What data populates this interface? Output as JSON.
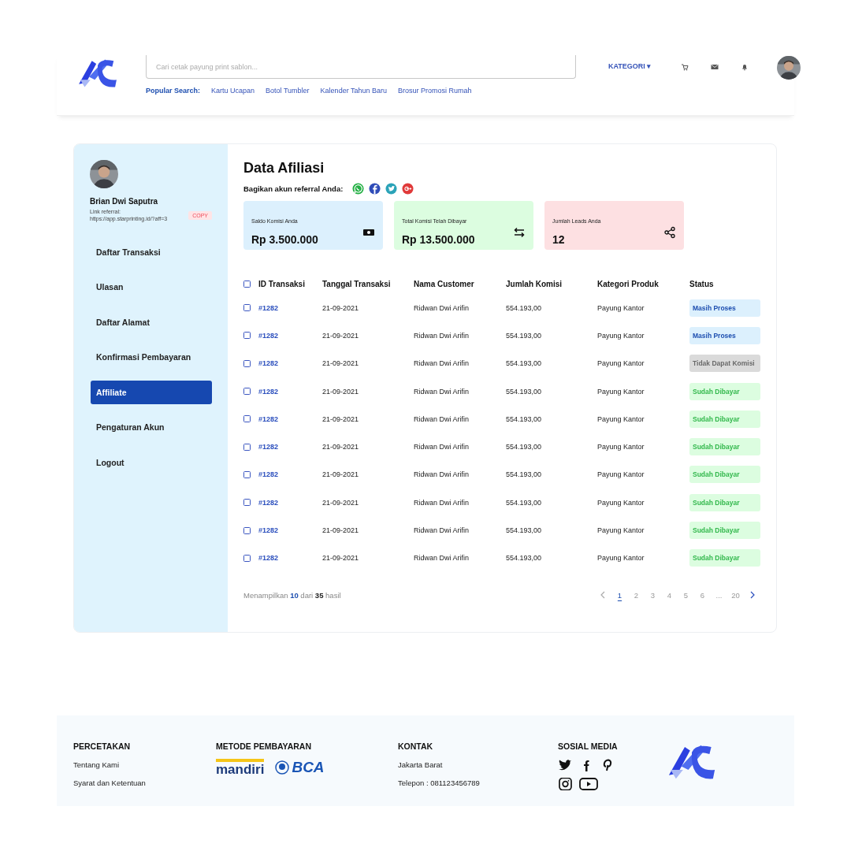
{
  "header": {
    "search": {
      "placeholder": "Cari cetak payung print sablon..."
    },
    "popular_label": "Popular Search:",
    "popular": [
      "Kartu Ucapan",
      "Botol Tumbler",
      "Kalender Tahun Baru",
      "Brosur Promosi Rumah"
    ],
    "category": "KATEGORI ▾"
  },
  "profile": {
    "name": "Brian Dwi Saputra",
    "referral_label": "Link referral:",
    "referral_link": "https://app.starprinting.id/?aff=3",
    "copy": "COPY"
  },
  "menu": [
    {
      "label": "Daftar Transaksi",
      "selected": false
    },
    {
      "label": "Ulasan",
      "selected": false
    },
    {
      "label": "Daftar Alamat",
      "selected": false
    },
    {
      "label": "Konfirmasi Pembayaran",
      "selected": false
    },
    {
      "label": "Affiliate",
      "selected": true
    },
    {
      "label": "Pengaturan Akun",
      "selected": false
    },
    {
      "label": "Logout",
      "selected": false
    }
  ],
  "page_title": "Data Afiliasi",
  "share_label": "Bagikan akun referral Anda:",
  "stats": [
    {
      "label": "Saldo Komisi Anda",
      "value": "Rp 3.500.000",
      "color": "#dcf0fd",
      "kind": "money"
    },
    {
      "label": "Total Komisi Telah Dibayar",
      "value": "Rp 13.500.000",
      "color": "#dcfde0",
      "kind": "transfer"
    },
    {
      "label": "Jumlah Leads Anda",
      "value": "12",
      "color": "#fde0e2",
      "kind": "share"
    }
  ],
  "table": {
    "header_checked": false,
    "columns": [
      "ID Transaksi",
      "Tanggal Transaksi",
      "Nama Customer",
      "Jumlah Komisi",
      "Kategori Produk",
      "Status"
    ],
    "rows": [
      {
        "checked": false,
        "id": "#1282",
        "date": "21-09-2021",
        "customer": "Ridwan Dwi Arifin",
        "amount": "554.193,00",
        "category": "Payung Kantor",
        "status": "Masih Proses",
        "kind": "process"
      },
      {
        "checked": false,
        "id": "#1282",
        "date": "21-09-2021",
        "customer": "Ridwan Dwi Arifin",
        "amount": "554.193,00",
        "category": "Payung Kantor",
        "status": "Masih Proses",
        "kind": "process"
      },
      {
        "checked": false,
        "id": "#1282",
        "date": "21-09-2021",
        "customer": "Ridwan Dwi Arifin",
        "amount": "554.193,00",
        "category": "Payung Kantor",
        "status": "Tidak Dapat Komisi",
        "kind": "none"
      },
      {
        "checked": false,
        "id": "#1282",
        "date": "21-09-2021",
        "customer": "Ridwan Dwi Arifin",
        "amount": "554.193,00",
        "category": "Payung Kantor",
        "status": "Sudah Dibayar",
        "kind": "paid"
      },
      {
        "checked": false,
        "id": "#1282",
        "date": "21-09-2021",
        "customer": "Ridwan Dwi Arifin",
        "amount": "554.193,00",
        "category": "Payung Kantor",
        "status": "Sudah Dibayar",
        "kind": "paid"
      },
      {
        "checked": false,
        "id": "#1282",
        "date": "21-09-2021",
        "customer": "Ridwan Dwi Arifin",
        "amount": "554.193,00",
        "category": "Payung Kantor",
        "status": "Sudah Dibayar",
        "kind": "paid"
      },
      {
        "checked": false,
        "id": "#1282",
        "date": "21-09-2021",
        "customer": "Ridwan Dwi Arifin",
        "amount": "554.193,00",
        "category": "Payung Kantor",
        "status": "Sudah Dibayar",
        "kind": "paid"
      },
      {
        "checked": false,
        "id": "#1282",
        "date": "21-09-2021",
        "customer": "Ridwan Dwi Arifin",
        "amount": "554.193,00",
        "category": "Payung Kantor",
        "status": "Sudah Dibayar",
        "kind": "paid"
      },
      {
        "checked": false,
        "id": "#1282",
        "date": "21-09-2021",
        "customer": "Ridwan Dwi Arifin",
        "amount": "554.193,00",
        "category": "Payung Kantor",
        "status": "Sudah Dibayar",
        "kind": "paid"
      },
      {
        "checked": false,
        "id": "#1282",
        "date": "21-09-2021",
        "customer": "Ridwan Dwi Arifin",
        "amount": "554.193,00",
        "category": "Payung Kantor",
        "status": "Sudah Dibayar",
        "kind": "paid"
      }
    ]
  },
  "pagination": {
    "summary": "Menampilkan **10** dari **35** hasil",
    "pages": [
      {
        "label": "1",
        "selected": true
      },
      {
        "label": "2",
        "selected": false
      },
      {
        "label": "3",
        "selected": false
      },
      {
        "label": "4",
        "selected": false
      },
      {
        "label": "5",
        "selected": false
      },
      {
        "label": "6",
        "selected": false
      },
      {
        "label": "...",
        "selected": false
      },
      {
        "label": "20",
        "selected": false
      }
    ]
  },
  "footer": {
    "percetakan": {
      "title": "PERCETAKAN",
      "links": [
        "Tentang Kami",
        "Syarat dan Ketentuan"
      ]
    },
    "payment": {
      "title": "METODE PEMBAYARAN",
      "banks": [
        "mandiri",
        "BCA"
      ]
    },
    "contact": {
      "title": "KONTAK",
      "lines": [
        "Jakarta Barat",
        "Telepon : 081123456789"
      ]
    },
    "social": {
      "title": "SOSIAL MEDIA"
    }
  }
}
